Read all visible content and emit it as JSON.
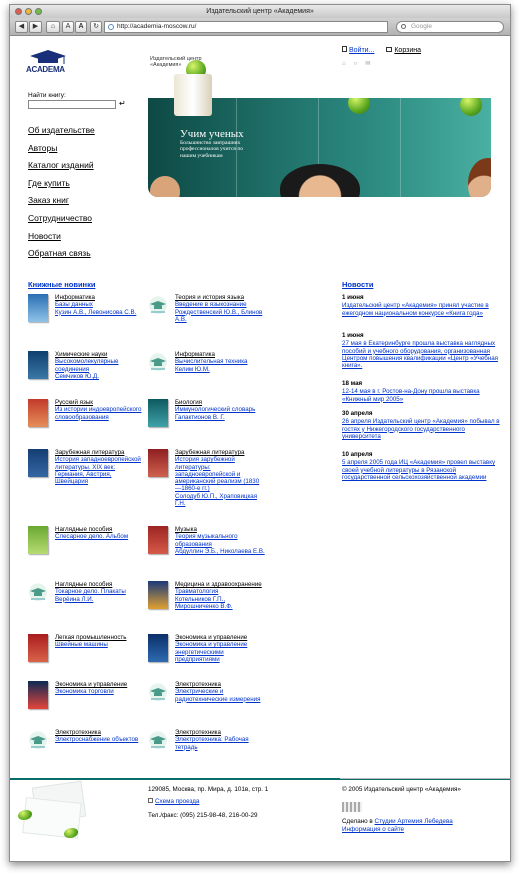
{
  "browser": {
    "window_title": "Издательский центр «Академия»",
    "url": "http://academia-moscow.ru/",
    "search_placeholder": "Google",
    "font_small": "A",
    "font_large": "A"
  },
  "header": {
    "logo_text": "ACADEMA",
    "center_title_line1": "Издательский центр",
    "center_title_line2": "«Академия»",
    "login": "Войти...",
    "cart": "Корзина"
  },
  "search": {
    "label": "Найти книгу:",
    "go": "↵"
  },
  "nav": [
    "Об издательстве",
    "Авторы",
    "Каталог изданий",
    "Где купить",
    "Заказ книг",
    "Сотрудничество",
    "Новости",
    "Обратная связь"
  ],
  "banner": {
    "title": "Учим ученых",
    "subtitle": "Большинство завтрашних профессионалов учится по нашим учебникам"
  },
  "new_books": {
    "heading": "Книжные новинки",
    "left": [
      {
        "cat": "Информатика",
        "title": "Базы данных",
        "author": "Кузин А.В., Левонисова С.В."
      },
      {
        "cat": "Химические науки",
        "title": "Высокомолекулярные соединения",
        "author": "Семчиков Ю.Д."
      },
      {
        "cat": "Русский язык",
        "title": "Из истории индоевропейского словообразования",
        "author": ""
      },
      {
        "cat": "Зарубежная литература",
        "title": "История западноевропейской литературы. XIX век: Германия, Австрия, Швейцария",
        "author": ""
      },
      {
        "cat": "Наглядные пособия",
        "title": "Слесарное дело. Альбом",
        "author": ""
      },
      {
        "cat": "Наглядные пособия",
        "title": "Токарное дело. Плакаты",
        "author": "Верёина Л.И."
      },
      {
        "cat": "Легкая промышленность",
        "title": "Швейные машины",
        "author": ""
      },
      {
        "cat": "Экономика и управление",
        "title": "Экономика торговли",
        "author": ""
      },
      {
        "cat": "Электротехника",
        "title": "Электроснабжение объектов",
        "author": ""
      }
    ],
    "right": [
      {
        "cat": "Теория и история языка",
        "title": "Введение в языкознание",
        "author": "Рождественский Ю.В., Блинов А.В."
      },
      {
        "cat": "Информатика",
        "title": "Вычислительная техника",
        "author": "Келим Ю.М."
      },
      {
        "cat": "Биология",
        "title": "Иммунологический словарь",
        "author": "Галактионов В. Г."
      },
      {
        "cat": "Зарубежная литература",
        "title": "История зарубежной литературы: западноевропейской и американский реализм (1830—1860-е гг.)",
        "author": "Солодуб Ю.П., Храповицкая Г.Н."
      },
      {
        "cat": "Музыка",
        "title": "Теория музыкального образования",
        "author": "Абдуллин Э.Б., Николаева Е.В."
      },
      {
        "cat": "Медицина и здравоохранение",
        "title": "Травматология",
        "author": "Котельников Г.П., Мирошниченко В.Ф."
      },
      {
        "cat": "Экономика и управление",
        "title": "Экономика и управление энергетическими предприятиями",
        "author": ""
      },
      {
        "cat": "Электротехника",
        "title": "Электрические и радиотехнические измерения",
        "author": ""
      },
      {
        "cat": "Электротехника",
        "title": "Электротехника: Рабочая тетрадь",
        "author": ""
      }
    ]
  },
  "news": {
    "heading": "Новости",
    "items": [
      {
        "date": "1 июня",
        "text": "Издательский центр «Академия» принял участие в ежегодном национальном конкурсе «Книга года»"
      },
      {
        "date": "1 июня",
        "text": "27 мая в Екатеринбурге прошла выставка наглядных пособий и учебного оборудования, организованная Центром повышения квалификации «Центр «Учебная книга»."
      },
      {
        "date": "18 мая",
        "text": "12-14 мая в г. Ростов-на-Дону прошла выставка «Книжный мир 2005»"
      },
      {
        "date": "30 апреля",
        "text": "26 апреля Издательский центр «Академия» побывал в гостях у Нижегородского государственного университета"
      },
      {
        "date": "10 апреля",
        "text": "5 апреля 2005 года ИЦ «Академия» провел выставку своей учебной литературы в Рязанской государственной сельскохозяйственной академии"
      }
    ]
  },
  "footer": {
    "address": "129085, Москва, пр. Мира, д. 101в, стр. 1",
    "map_link": "Схема проезда",
    "phone": "Тел./факс: (095) 215-98-48, 216-00-29",
    "copyright": "© 2005 Издательский центр «Академия»",
    "made_by_prefix": "Сделано в",
    "made_by_link": "Студии Артемия Лебедева",
    "info_link": "Информация о сайте"
  },
  "colors": {
    "link": "#0033cc",
    "banner_dark": "#0e4945",
    "banner_light": "#4ab0a2",
    "footer_rule": "#0a6e68"
  }
}
